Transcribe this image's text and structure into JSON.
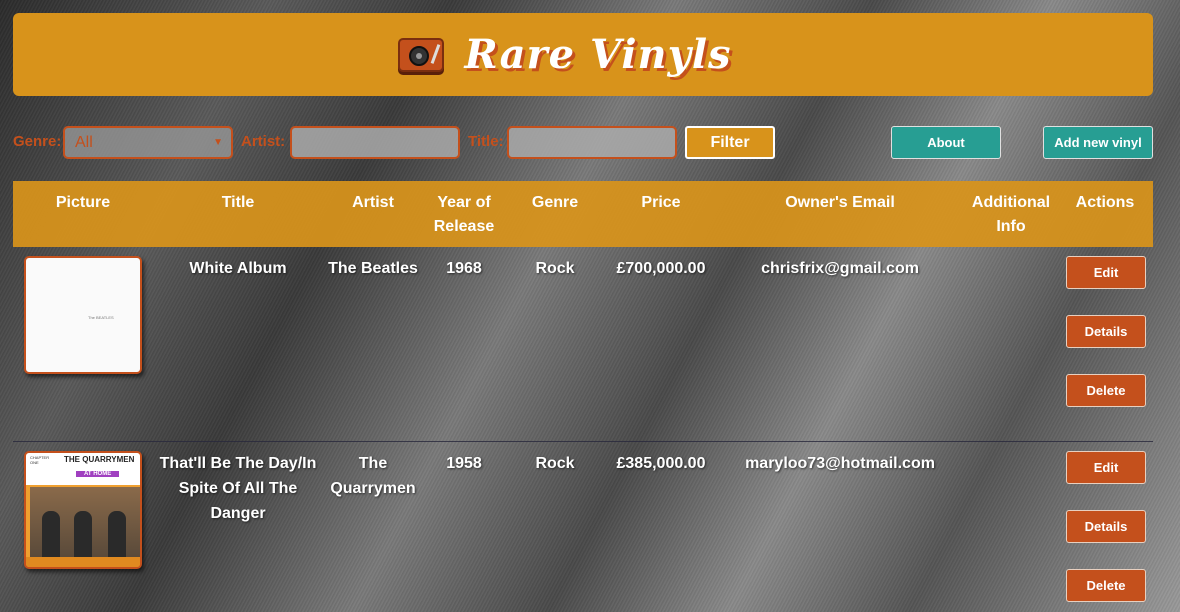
{
  "header": {
    "title": "Rare Vinyls",
    "logo_icon": "turntable-icon"
  },
  "filters": {
    "genre_label": "Genre:",
    "genre_value": "All",
    "artist_label": "Artist:",
    "artist_value": "",
    "title_label": "Title:",
    "title_value": "",
    "filter_button": "Filter",
    "about_button": "About",
    "add_button": "Add new vinyl"
  },
  "table": {
    "columns": [
      "Picture",
      "Title",
      "Artist",
      "Year of Release",
      "Genre",
      "Price",
      "Owner's Email",
      "Additional Info",
      "Actions"
    ],
    "rows": [
      {
        "cover_text": "The BEATLES",
        "title": "White Album",
        "artist": "The Beatles",
        "year": "1968",
        "genre": "Rock",
        "price": "£700,000.00",
        "email": "chrisfrix@gmail.com",
        "info": "",
        "edit": "Edit",
        "details": "Details",
        "delete": "Delete"
      },
      {
        "cover_text": "THE QUARRYMEN",
        "cover_sub": "AT HOME",
        "cover_label": "CHAPTER ONE",
        "title": "That'll Be The Day/In Spite Of All The Danger",
        "artist": "The Quarrymen",
        "year": "1958",
        "genre": "Rock",
        "price": "£385,000.00",
        "email": "maryloo73@hotmail.com",
        "info": "",
        "edit": "Edit",
        "details": "Details",
        "delete": "Delete"
      }
    ]
  },
  "colors": {
    "accent": "#d8931b",
    "action": "#c4501c",
    "teal": "#279e93"
  }
}
